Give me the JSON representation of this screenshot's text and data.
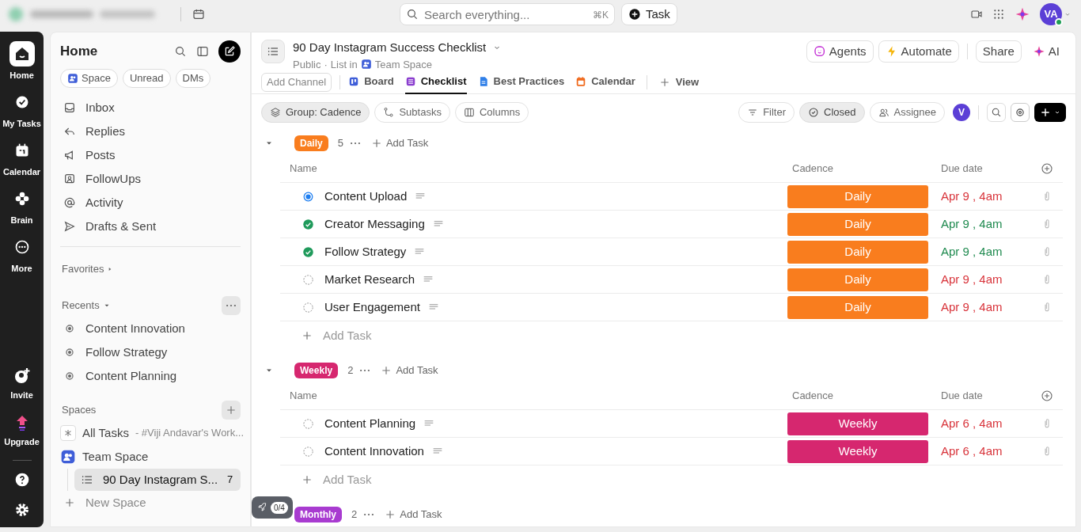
{
  "topbar": {
    "search": {
      "placeholder": "Search everything...",
      "shortcut": "⌘K"
    },
    "task_button": "Task",
    "avatar": "VA",
    "online": true
  },
  "rail": {
    "items": [
      {
        "label": "Home",
        "selected": true
      },
      {
        "label": "My Tasks",
        "selected": false
      },
      {
        "label": "Calendar",
        "selected": false
      },
      {
        "label": "Brain",
        "selected": false
      },
      {
        "label": "More",
        "selected": false
      }
    ],
    "bottom": [
      "Invite",
      "Upgrade"
    ]
  },
  "sidebar": {
    "title": "Home",
    "filters": [
      "Space",
      "Unread",
      "DMs"
    ],
    "nav": [
      "Inbox",
      "Replies",
      "Posts",
      "FollowUps",
      "Activity",
      "Drafts & Sent"
    ],
    "favorites": "Favorites",
    "recents": {
      "title": "Recents",
      "items": [
        "Content Innovation",
        "Follow Strategy",
        "Content Planning"
      ]
    },
    "spaces": {
      "title": "Spaces",
      "items": [
        {
          "kind": "all",
          "label": "All Tasks",
          "note": "- #Viji Andavar's Work..."
        },
        {
          "kind": "space",
          "label": "Team Space"
        },
        {
          "kind": "list",
          "label": "90 Day Instagram S...",
          "count": "7",
          "selected": true
        }
      ],
      "new_space": "New Space"
    }
  },
  "list": {
    "title": "90 Day Instagram Success Checklist",
    "visibility": "Public",
    "separator": "·",
    "location_prefix": "List in",
    "location": "Team Space",
    "actions": [
      "Agents",
      "Automate",
      "Share",
      "AI"
    ],
    "add_channel": "Add Channel",
    "views": [
      {
        "label": "Board",
        "selected": false
      },
      {
        "label": "Checklist",
        "selected": true
      },
      {
        "label": "Best Practices",
        "selected": false
      },
      {
        "label": "Calendar",
        "selected": false
      }
    ],
    "add_view": "View",
    "toolbar_left": [
      {
        "label": "Group: Cadence",
        "selected": true
      },
      {
        "label": "Subtasks",
        "selected": false
      },
      {
        "label": "Columns",
        "selected": false
      }
    ],
    "toolbar_right": [
      {
        "label": "Filter",
        "selected": false
      },
      {
        "label": "Closed",
        "selected": true
      },
      {
        "label": "Assignee",
        "selected": false
      }
    ],
    "assignee_avatar": "V",
    "groups": [
      {
        "label": "Daily",
        "color": "#f97d1e",
        "count": "5",
        "add_task": "Add Task",
        "columns": [
          "Name",
          "Cadence",
          "Due date"
        ],
        "tasks": [
          {
            "name": "Content Upload",
            "kind": "in_progress",
            "cadence": "Daily",
            "due": "Apr 9 , 4am"
          },
          {
            "name": "Creator Messaging",
            "kind": "complete",
            "cadence": "Daily",
            "due": "Apr 9 , 4am"
          },
          {
            "name": "Follow Strategy",
            "kind": "complete",
            "cadence": "Daily",
            "due": "Apr 9 , 4am"
          },
          {
            "name": "Market Research",
            "kind": "todo",
            "cadence": "Daily",
            "due": "Apr 9 , 4am"
          },
          {
            "name": "User Engagement",
            "kind": "todo",
            "cadence": "Daily",
            "due": "Apr 9 , 4am"
          }
        ],
        "add_row": "Add Task"
      },
      {
        "label": "Weekly",
        "color": "#d6276f",
        "count": "2",
        "add_task": "Add Task",
        "columns": [
          "Name",
          "Cadence",
          "Due date"
        ],
        "tasks": [
          {
            "name": "Content Planning",
            "kind": "todo",
            "cadence": "Weekly",
            "due": "Apr 6 , 4am"
          },
          {
            "name": "Content Innovation",
            "kind": "todo",
            "cadence": "Weekly",
            "due": "Apr 6 , 4am"
          }
        ],
        "add_row": "Add Task"
      },
      {
        "label": "Monthly",
        "color": "#a83bd0",
        "count": "2",
        "add_task": "Add Task"
      }
    ]
  },
  "onboarding": {
    "progress": "0/4"
  }
}
